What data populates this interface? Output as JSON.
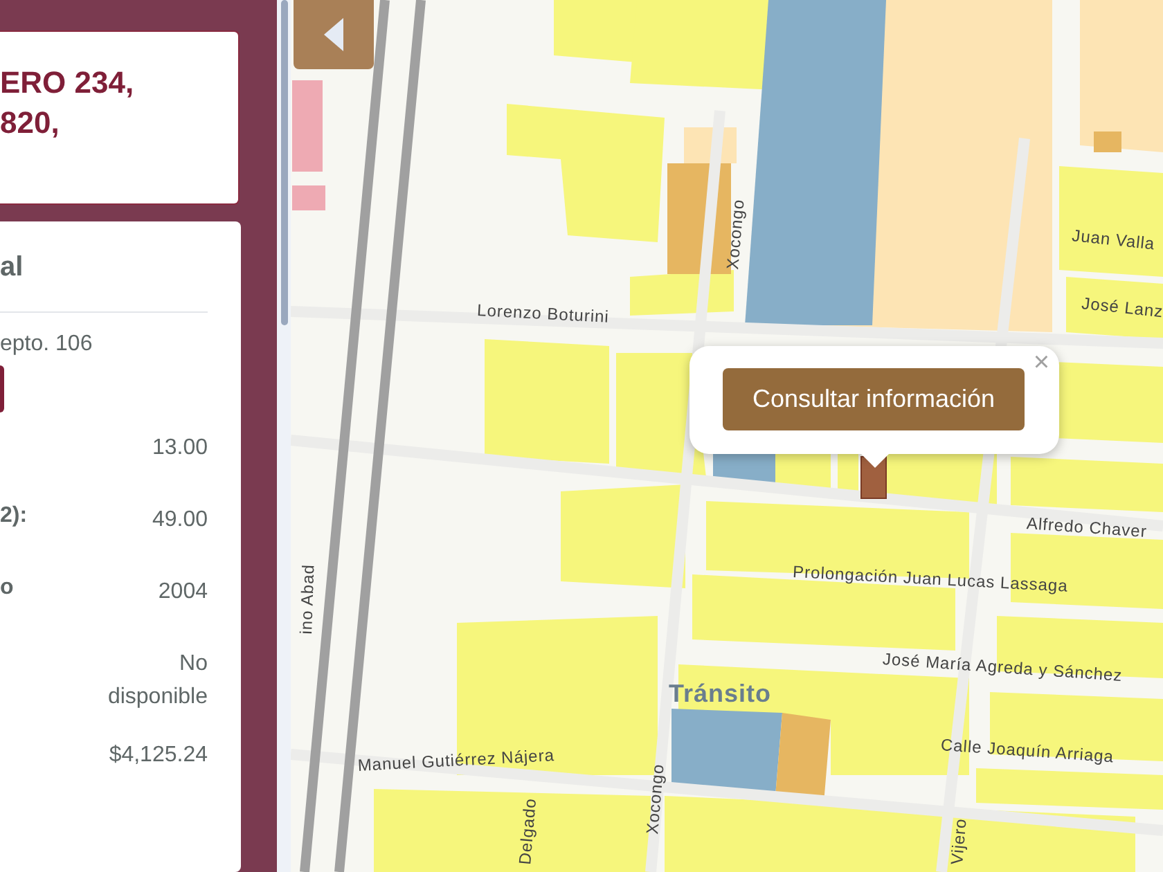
{
  "panel": {
    "address_card": {
      "lines": [
        "ERO 234,",
        "820,"
      ]
    },
    "details_card": {
      "heading": "al",
      "subtitle": "epto. 106",
      "rows": [
        {
          "value": "13.00"
        },
        {
          "label": "2):",
          "value": "49.00"
        },
        {
          "label": "o",
          "value": "2004"
        },
        {
          "value": "No disponible"
        },
        {
          "value": "$4,125.24"
        }
      ]
    }
  },
  "map": {
    "labels": [
      {
        "text": "Lorenzo Boturini"
      },
      {
        "text": "Xocongo"
      },
      {
        "text": "Juan Valla"
      },
      {
        "text": "José Lanz"
      },
      {
        "text": "Alfredo Chaver"
      },
      {
        "text": "Prolongación Juan Lucas Lassaga"
      },
      {
        "text": "José María Agreda y Sánchez"
      },
      {
        "text": "Calle Joaquín Arriaga"
      },
      {
        "text": "Manuel Gutiérrez Nájera"
      },
      {
        "text": "Tránsito"
      },
      {
        "text": "Xocongo"
      },
      {
        "text": "Delgado"
      },
      {
        "text": "Vijero"
      },
      {
        "text": "ino Abad"
      }
    ],
    "popup": {
      "button": "Consultar información",
      "close": "×"
    }
  }
}
